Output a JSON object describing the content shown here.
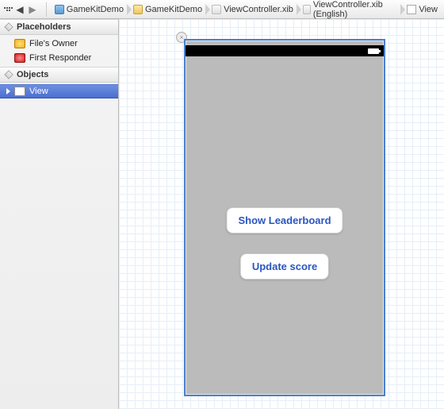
{
  "breadcrumb": [
    {
      "label": "GameKitDemo",
      "icon": "xcode-project-icon"
    },
    {
      "label": "GameKitDemo",
      "icon": "folder-icon"
    },
    {
      "label": "ViewController.xib",
      "icon": "xib-file-icon"
    },
    {
      "label": "ViewController.xib (English)",
      "icon": "xib-file-icon"
    },
    {
      "label": "View",
      "icon": "view-icon"
    }
  ],
  "outline": {
    "placeholders_header": "Placeholders",
    "objects_header": "Objects",
    "placeholders": [
      {
        "label": "File's Owner",
        "icon": "files-owner-icon"
      },
      {
        "label": "First Responder",
        "icon": "first-responder-icon"
      }
    ],
    "objects": [
      {
        "label": "View",
        "icon": "view-icon",
        "selected": true
      }
    ]
  },
  "canvas": {
    "button1_label": "Show Leaderboard",
    "button2_label": "Update score"
  },
  "colors": {
    "selection": "#4a6fcf",
    "canvas_selection": "#4a80d0",
    "ios_button_text": "#2a55c0"
  }
}
